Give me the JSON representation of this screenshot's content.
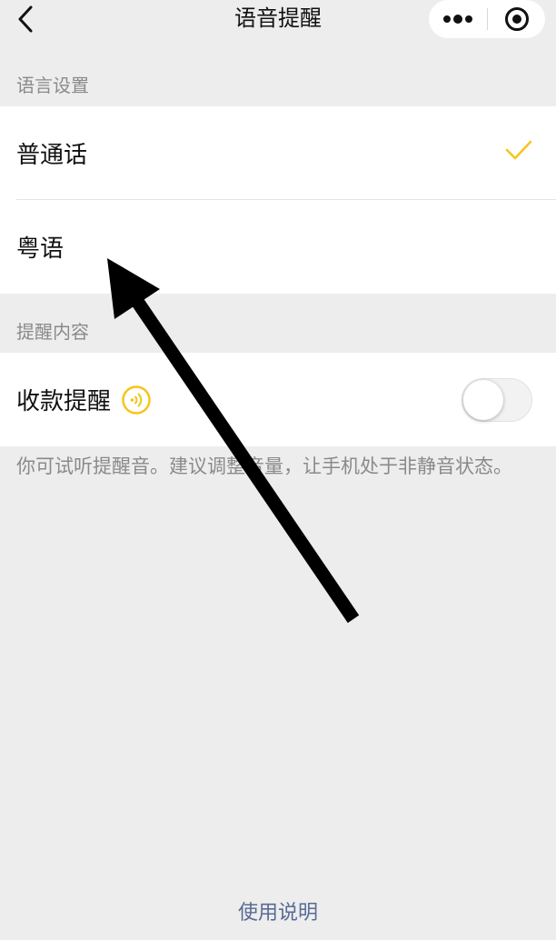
{
  "navbar": {
    "title": "语音提醒",
    "back_icon": "chevron-left-icon",
    "more_icon": "more-dots-icon",
    "close_icon": "target-circle-icon"
  },
  "language_section": {
    "header": "语言设置",
    "items": [
      {
        "label": "普通话",
        "selected": true
      },
      {
        "label": "粤语",
        "selected": false
      }
    ]
  },
  "content_section": {
    "header": "提醒内容",
    "toggle_label": "收款提醒",
    "toggle_on": false,
    "sound_icon": "sound-wave-icon"
  },
  "tip": "你可试听提醒音。建议调整音量，让手机处于非静音状态。",
  "footer": {
    "link": "使用说明"
  },
  "colors": {
    "accent": "#f5c518",
    "link": "#576b95",
    "background": "#ededed"
  }
}
